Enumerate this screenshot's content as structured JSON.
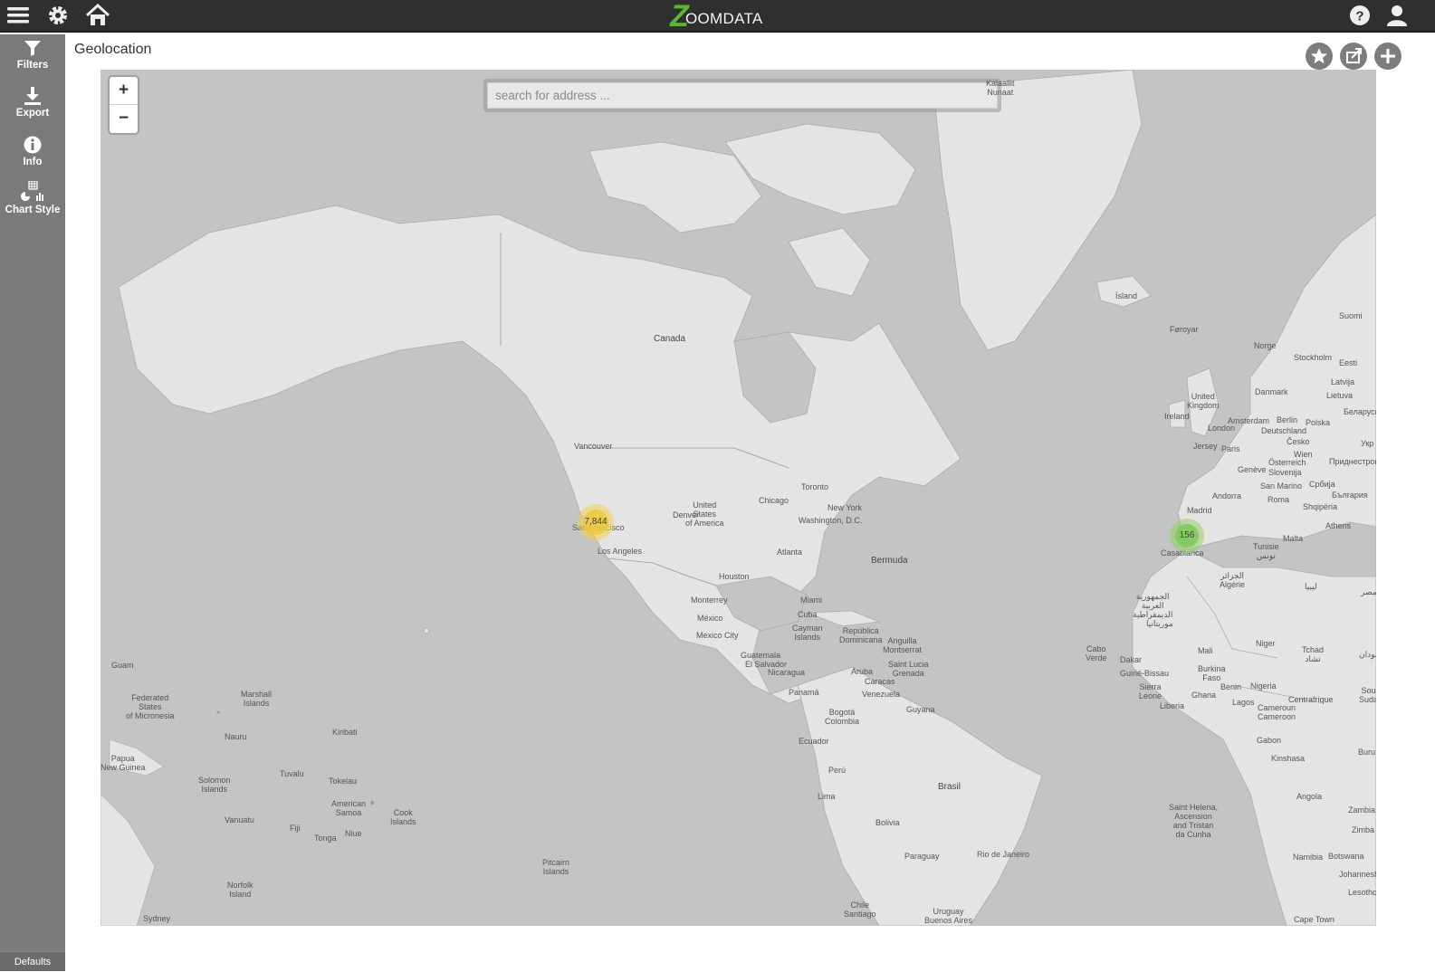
{
  "app": {
    "logo_text": "OOMDATA",
    "logo_mark": "Z"
  },
  "topbar": {
    "icons": [
      "menu-icon",
      "gear-icon",
      "home-icon",
      "help-icon",
      "user-icon"
    ]
  },
  "sidebar": {
    "items": [
      {
        "label": "Filters",
        "icon": "filter-icon"
      },
      {
        "label": "Export",
        "icon": "download-icon"
      },
      {
        "label": "Info",
        "icon": "info-icon"
      },
      {
        "label": "Chart Style",
        "icon": "chart-style-icon"
      }
    ],
    "defaults_label": "Defaults"
  },
  "page": {
    "title": "Geolocation"
  },
  "actions": [
    "star-icon",
    "share-icon",
    "plus-icon"
  ],
  "map": {
    "search_placeholder": "search for address ...",
    "zoom_in": "+",
    "zoom_out": "−",
    "clusters": [
      {
        "count": "7,844",
        "color": "#f0d24a"
      },
      {
        "count": "156",
        "color": "#8fd16a"
      }
    ],
    "labels": {
      "canada": "Canada",
      "usa": "United\nStates\nof America",
      "denver": "Denver",
      "vancouver": "Vancouver",
      "chicago": "Chicago",
      "toronto": "Toronto",
      "newyork": "New York",
      "washington": "Washington, D.C.",
      "atlanta": "Atlanta",
      "houston": "Houston",
      "monterrey": "Monterrey",
      "mexico": "México",
      "mexicocity": "Mexico City",
      "losangeles": "Los Angeles",
      "sanfrancisco": "San Francisco",
      "miami": "Miami",
      "cuba": "Cuba",
      "cayman": "Cayman\nIslands",
      "bermuda": "Bermuda",
      "guatemala": "Guatemala",
      "elsalvador": "El Salvador",
      "nicaragua": "Nicaragua",
      "panama": "Panamá",
      "republica": "República\nDominicana",
      "anguilla": "Anguilla\nMontserrat",
      "aruba": "Aruba",
      "caracas": "Caracas",
      "saintlucia": "Saint Lucia\nGrenada",
      "venezuela": "Venezuela",
      "guyana": "Guyana",
      "bogota": "Bogotá\nColombia",
      "ecuador": "Ecuador",
      "peru": "Perú",
      "lima": "Lima",
      "brasil": "Brasil",
      "bolivia": "Bolivia",
      "paraguay": "Paraguay",
      "rio": "Rio de Janeiro",
      "chile": "Chile\nSantiago",
      "uruguay": "Uruguay\nBuenos Aires",
      "guam": "Guam",
      "micronesia": "Federated\nStates\nof Micronesia",
      "marshall": "Marshall\nIslands",
      "nauru": "Nauru",
      "kiribati": "Kiribati",
      "papua": "Papua\nNew Guinea",
      "solomon": "Solomon\nIslands",
      "tuvalu": "Tuvalu",
      "tokelau": "Tokelau",
      "samoa": "American\nSamoa",
      "cook": "Cook\nIslands",
      "vanuatu": "Vanuatu",
      "fiji": "Fiji",
      "tonga": "Tonga",
      "niue": "Niue",
      "pitcairn": "Pitcairn\nIslands",
      "norfolk": "Norfolk\nIsland",
      "sydney": "Sydney",
      "kalaallit": "Kalaallit\nNunaat",
      "island": "Ísland",
      "foroyar": "Føroyar",
      "norge": "Norge",
      "suomi": "Suomi",
      "stockholm": "Stockholm",
      "eesti": "Eesti",
      "latvija": "Latvija",
      "lietuva": "Lietuva",
      "uk": "United\nKingdom",
      "london": "London",
      "ireland": "Ireland",
      "danmark": "Danmark",
      "amsterdam": "Amsterdam",
      "berlin": "Berlin",
      "polska": "Polska",
      "belarus": "Беларусь",
      "deutschland": "Deutschland",
      "jersey": "Jersey",
      "paris": "Paris",
      "cesko": "Česko",
      "wien": "Wien",
      "osterreich": "Österreich",
      "pridnestrovie": "Приднестровье",
      "geneve": "Genève",
      "slovenija": "Slovenija",
      "sanmarino": "San Marino",
      "srbija": "Србија",
      "bulgaria": "България",
      "andorra": "Andorra",
      "madrid": "Madrid",
      "roma": "Roma",
      "shqiperia": "Shqipëria",
      "athens": "Athens",
      "casablanca": "Casablanca",
      "malta": "Malta",
      "tunisie": "Tunisie\nتونس",
      "algerie": "الجزائر\nAlgérie",
      "libya": "ليبيا",
      "sahara": "الجمهورية\nالعربية\nالديمقراطية",
      "mauritanie": "موريتانيا",
      "mali": "Mali",
      "niger": "Niger",
      "tchad": "Tchad\nتشاد",
      "caboverde": "Cabo\nVerde",
      "dakar": "Dakar",
      "guinebissau": "Guiné-Bissau",
      "sierraleone": "Sierra\nLeone",
      "liberia": "Liberia",
      "burkina": "Burkina\nFaso",
      "ghana": "Ghana",
      "benin": "Benin",
      "nigeria": "Nigeria",
      "lagos": "Lagos",
      "centrafrique": "Centrafrique",
      "cameroun": "Cameroun\nCameroon",
      "gabon": "Gabon",
      "kinshasa": "Kinshasa",
      "angola": "Angola",
      "zambia": "Zambia",
      "namibia": "Namibia",
      "botswana": "Botswana",
      "johannesburg": "Johannesburg",
      "capetown": "Cape Town",
      "sainthelena": "Saint Helena,\nAscension\nand Tristan\nda Cunha",
      "lesotho": "Lesotho",
      "zimbabwe": "Zimba",
      "sudan": "السودان",
      "south": "Sou\nSuda",
      "burundi": "Buru",
      "egypt": "مصر",
      "ukr": "Укр"
    }
  }
}
